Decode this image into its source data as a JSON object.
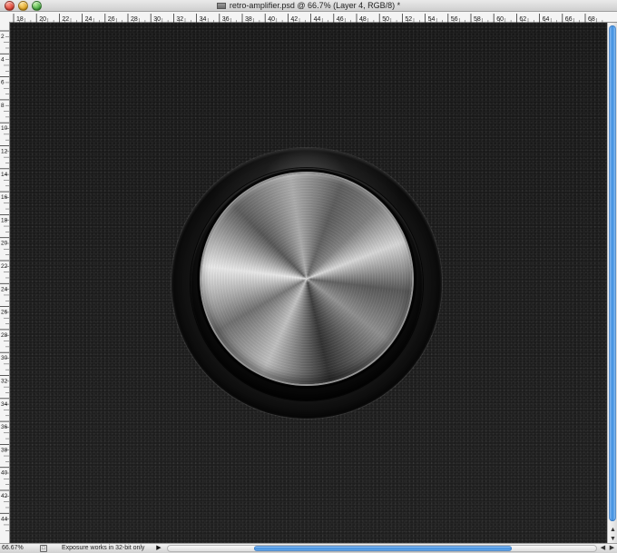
{
  "window": {
    "title": "retro-amplifier.psd @ 66.7% (Layer 4, RGB/8) *",
    "controls": {
      "close": "close-button",
      "minimize": "minimize-button",
      "zoom": "zoom-button"
    }
  },
  "rulers": {
    "top_labels": [
      "18",
      "20",
      "22",
      "24",
      "26",
      "28",
      "30",
      "32",
      "34",
      "36",
      "38",
      "40",
      "42",
      "44",
      "46",
      "48",
      "50",
      "52",
      "54",
      "56",
      "58",
      "60",
      "62",
      "64",
      "66",
      "68"
    ],
    "left_labels": [
      "2",
      "4",
      "6",
      "8",
      "10",
      "12",
      "14",
      "16",
      "18",
      "20",
      "22",
      "24",
      "26",
      "28",
      "30",
      "32",
      "34",
      "36",
      "38",
      "40",
      "42",
      "44"
    ]
  },
  "status": {
    "zoom": "66.67%",
    "message": "Exposure works in 32-bit only",
    "menu_arrow": "▶"
  },
  "scrollbars": {
    "vertical_up": "▲",
    "vertical_down": "▼",
    "horizontal_left": "◀",
    "horizontal_right": "▶"
  },
  "artwork": {
    "description_icon": "metallic-knob-icon",
    "background_color": "#1c1c1c",
    "metal_color": "#bdbdbd",
    "accent_color": "#3d8ee0"
  }
}
